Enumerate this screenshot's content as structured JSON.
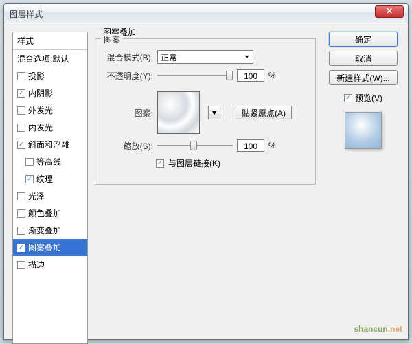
{
  "window": {
    "title": "图层样式"
  },
  "sidebar": {
    "header": "样式",
    "blend_defaults": "混合选项:默认",
    "items": [
      {
        "label": "投影",
        "checked": false,
        "indent": false
      },
      {
        "label": "内阴影",
        "checked": true,
        "indent": false
      },
      {
        "label": "外发光",
        "checked": false,
        "indent": false
      },
      {
        "label": "内发光",
        "checked": false,
        "indent": false
      },
      {
        "label": "斜面和浮雕",
        "checked": true,
        "indent": false
      },
      {
        "label": "等高线",
        "checked": false,
        "indent": true
      },
      {
        "label": "纹理",
        "checked": true,
        "indent": true
      },
      {
        "label": "光泽",
        "checked": false,
        "indent": false
      },
      {
        "label": "颜色叠加",
        "checked": false,
        "indent": false
      },
      {
        "label": "渐变叠加",
        "checked": false,
        "indent": false
      },
      {
        "label": "图案叠加",
        "checked": true,
        "indent": false,
        "selected": true
      },
      {
        "label": "描边",
        "checked": false,
        "indent": false
      }
    ]
  },
  "panel": {
    "title": "图案叠加",
    "group": "图案",
    "blend_mode_label": "混合模式(B):",
    "blend_mode_value": "正常",
    "opacity_label": "不透明度(Y):",
    "opacity_value": "100",
    "percent": "%",
    "pattern_label": "图案:",
    "snap_origin": "贴紧原点(A)",
    "scale_label": "缩放(S):",
    "scale_value": "100",
    "link_label": "与图层链接(K)",
    "link_checked": true
  },
  "buttons": {
    "ok": "确定",
    "cancel": "取消",
    "new_style": "新建样式(W)...",
    "preview": "预览(V)",
    "preview_checked": true
  },
  "watermark": {
    "text1": "shancun",
    "text2": ".net"
  }
}
